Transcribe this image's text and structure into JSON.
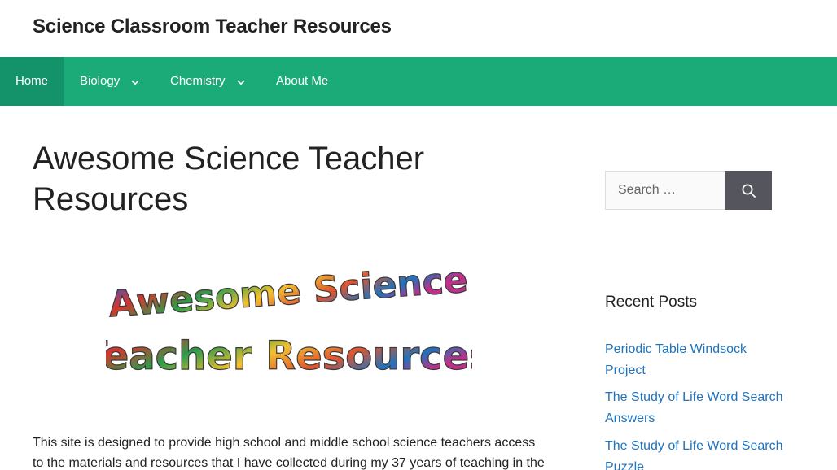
{
  "header": {
    "site_title": "Science Classroom Teacher Resources"
  },
  "nav": {
    "items": [
      {
        "label": "Home",
        "active": true,
        "has_dropdown": false
      },
      {
        "label": "Biology",
        "active": false,
        "has_dropdown": true
      },
      {
        "label": "Chemistry",
        "active": false,
        "has_dropdown": true
      },
      {
        "label": "About Me",
        "active": false,
        "has_dropdown": false
      }
    ]
  },
  "main": {
    "title": "Awesome Science Teacher Resources",
    "hero_image": {
      "line1": "Awesome Science",
      "line2": "Teacher Resources"
    },
    "intro": "This site is designed to provide high school and middle school science teachers access to the materials and resources that I have collected during my 37 years of teaching in the"
  },
  "sidebar": {
    "search": {
      "placeholder": "Search …"
    },
    "recent_posts": {
      "title": "Recent Posts",
      "items": [
        "Periodic Table Windsock Project",
        "The Study of Life Word Search Answers",
        "The Study of Life Word Search Puzzle"
      ]
    }
  },
  "colors": {
    "nav_background": "#1aab78",
    "nav_active": "#14936a",
    "link": "#1e73be",
    "search_button": "#55555e"
  },
  "icons": {
    "search": "search-icon",
    "dropdown": "chevron-down-icon"
  }
}
